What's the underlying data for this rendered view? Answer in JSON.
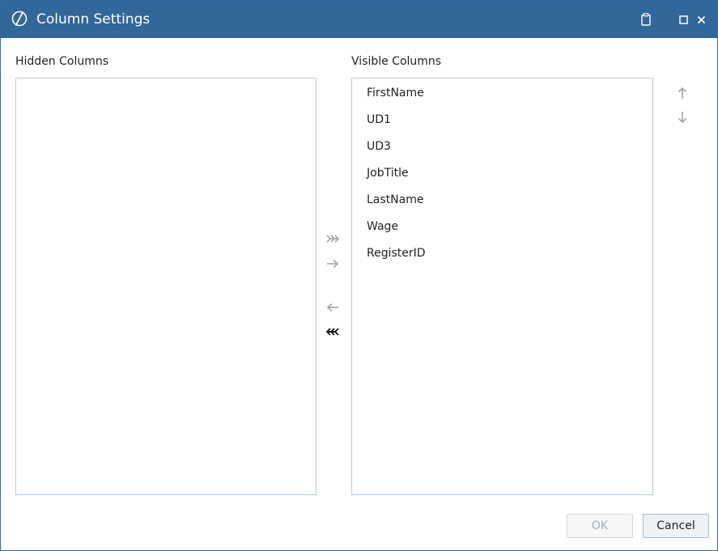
{
  "window": {
    "title": "Column Settings",
    "logo_icon": "ostendo-logo-icon",
    "titlebar_color": "#336699",
    "controls": [
      "clipboard-icon",
      "maximize-icon",
      "close-icon"
    ]
  },
  "hidden_columns": {
    "label": "Hidden Columns",
    "items": []
  },
  "visible_columns": {
    "label": "Visible Columns",
    "items": [
      "FirstName",
      "UD1",
      "UD3",
      "JobTitle",
      "LastName",
      "Wage",
      "RegisterID"
    ]
  },
  "transfer_buttons": {
    "move_all_right": {
      "icon": "double-arrow-right-icon",
      "enabled": false
    },
    "move_right": {
      "icon": "arrow-right-icon",
      "enabled": false
    },
    "move_left": {
      "icon": "arrow-left-icon",
      "enabled": false
    },
    "move_all_left": {
      "icon": "double-arrow-left-icon",
      "enabled": true
    }
  },
  "order_buttons": {
    "move_up": {
      "icon": "arrow-up-icon",
      "enabled": false
    },
    "move_down": {
      "icon": "arrow-down-icon",
      "enabled": false
    }
  },
  "footer": {
    "ok_label": "OK",
    "ok_enabled": false,
    "cancel_label": "Cancel"
  }
}
